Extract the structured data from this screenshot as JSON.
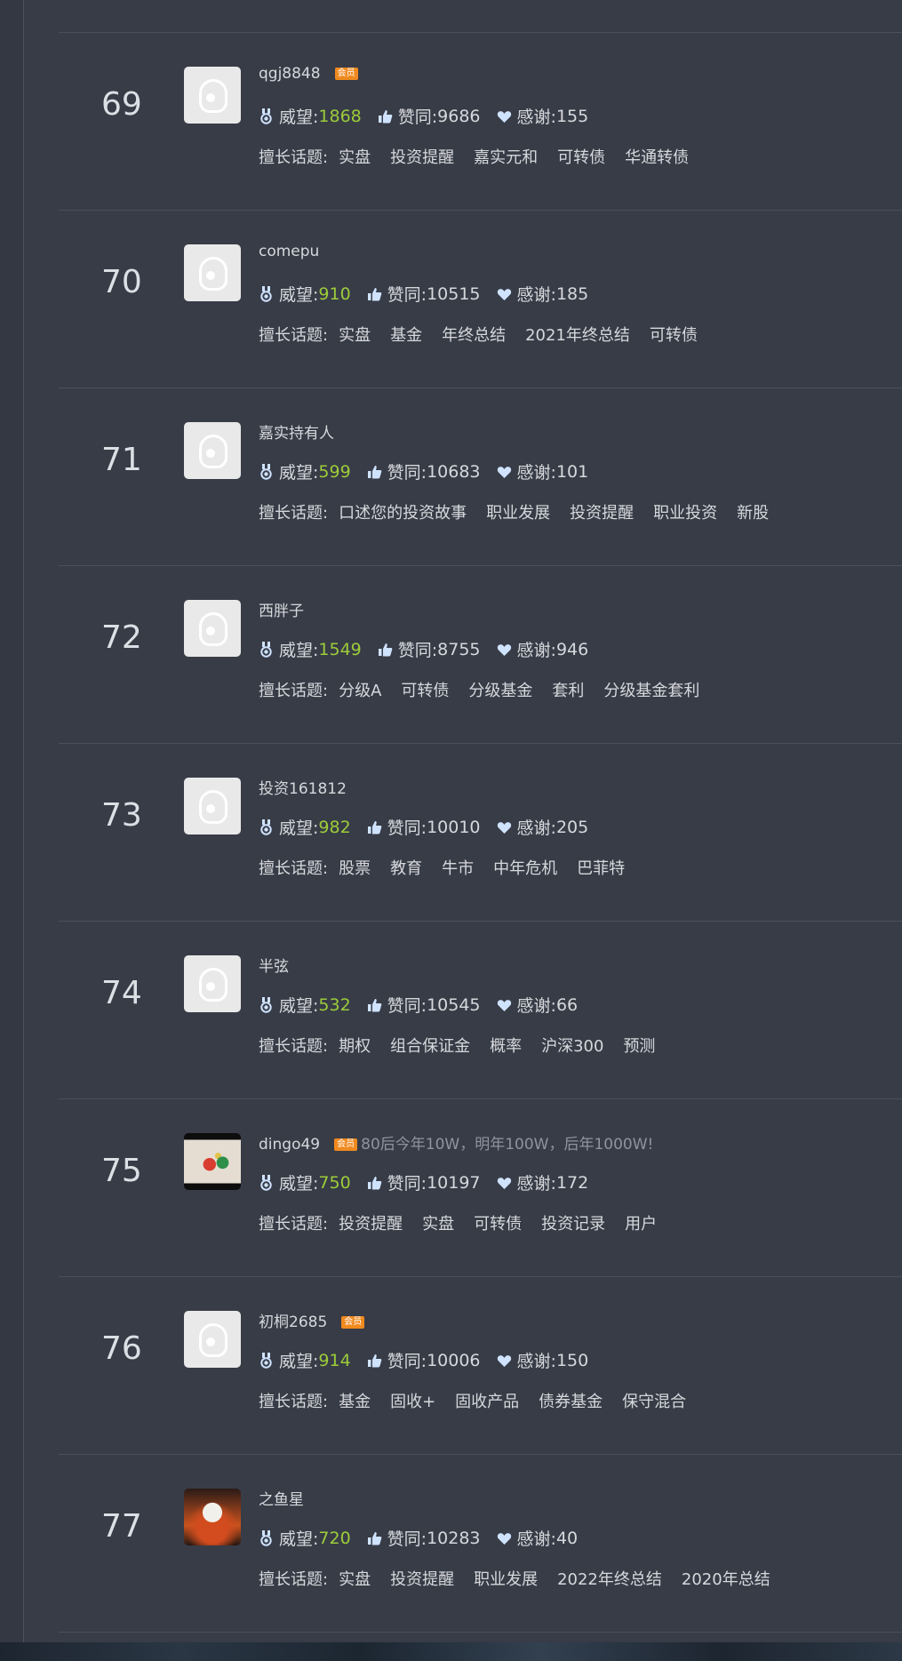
{
  "labels": {
    "prestige": "威望: ",
    "approve": "赞同: ",
    "thanks": "感谢: ",
    "topics": "擅长话题:"
  },
  "vip_badge": "会员",
  "users": [
    {
      "rank": "69",
      "name": "qgj8848",
      "vip": true,
      "motto": "",
      "prestige": "1868",
      "approve": "9686",
      "thanks": "155",
      "avatar": "default",
      "topics": [
        "实盘",
        "投资提醒",
        "嘉实元和",
        "可转债",
        "华通转债"
      ]
    },
    {
      "rank": "70",
      "name": "comepu",
      "vip": false,
      "motto": "",
      "prestige": "910",
      "approve": "10515",
      "thanks": "185",
      "avatar": "default",
      "topics": [
        "实盘",
        "基金",
        "年终总结",
        "2021年终总结",
        "可转债"
      ]
    },
    {
      "rank": "71",
      "name": "嘉实持有人",
      "vip": false,
      "motto": "",
      "prestige": "599",
      "approve": "10683",
      "thanks": "101",
      "avatar": "default",
      "topics": [
        "口述您的投资故事",
        "职业发展",
        "投资提醒",
        "职业投资",
        "新股"
      ]
    },
    {
      "rank": "72",
      "name": "西胖子",
      "vip": false,
      "motto": "",
      "prestige": "1549",
      "approve": "8755",
      "thanks": "946",
      "avatar": "default",
      "topics": [
        "分级A",
        "可转债",
        "分级基金",
        "套利",
        "分级基金套利"
      ]
    },
    {
      "rank": "73",
      "name": "投资161812",
      "vip": false,
      "motto": "",
      "prestige": "982",
      "approve": "10010",
      "thanks": "205",
      "avatar": "default",
      "topics": [
        "股票",
        "教育",
        "牛市",
        "中年危机",
        "巴菲特"
      ]
    },
    {
      "rank": "74",
      "name": "半弦",
      "vip": false,
      "motto": "",
      "prestige": "532",
      "approve": "10545",
      "thanks": "66",
      "avatar": "default",
      "topics": [
        "期权",
        "组合保证金",
        "概率",
        "沪深300",
        "预测"
      ]
    },
    {
      "rank": "75",
      "name": "dingo49",
      "vip": true,
      "motto": "80后今年10W，明年100W，后年1000W!",
      "prestige": "750",
      "approve": "10197",
      "thanks": "172",
      "avatar": "photo1",
      "topics": [
        "投资提醒",
        "实盘",
        "可转债",
        "投资记录",
        "用户"
      ]
    },
    {
      "rank": "76",
      "name": "初桐2685",
      "vip": true,
      "motto": "",
      "prestige": "914",
      "approve": "10006",
      "thanks": "150",
      "avatar": "default",
      "topics": [
        "基金",
        "固收+",
        "固收产品",
        "债券基金",
        "保守混合"
      ]
    },
    {
      "rank": "77",
      "name": "之鱼星",
      "vip": false,
      "motto": "",
      "prestige": "720",
      "approve": "10283",
      "thanks": "40",
      "avatar": "photo2",
      "topics": [
        "实盘",
        "投资提醒",
        "职业发展",
        "2022年终总结",
        "2020年总结"
      ]
    }
  ],
  "colors": {
    "background": "#383c47",
    "prestige_value": "#9ccc3a",
    "vip_badge": "#f08a1f",
    "icon_blue": "#cfe3ff"
  },
  "icons": {
    "prestige": "medal-icon",
    "approve": "thumbs-up-icon",
    "thanks": "heart-icon"
  }
}
